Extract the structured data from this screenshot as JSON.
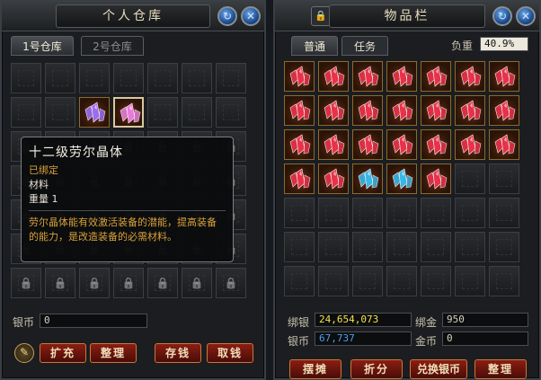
{
  "warehouse": {
    "title": "个人仓库",
    "tabs": [
      {
        "label": "1号仓库"
      },
      {
        "label": "2号仓库"
      }
    ],
    "silver_label": "银币",
    "silver_value": "0",
    "buttons": {
      "expand": "扩充",
      "sort": "整理",
      "deposit": "存钱",
      "withdraw": "取钱"
    }
  },
  "tooltip": {
    "name": "十二级劳尔晶体",
    "bound": "已绑定",
    "type": "材料",
    "weight": "重量 1",
    "description": "劳尔晶体能有效激活装备的潜能，提高装备的能力，是改造装备的必需材料。"
  },
  "inventory": {
    "title": "物品栏",
    "tabs": [
      {
        "label": "普通"
      },
      {
        "label": "任务"
      }
    ],
    "load_label": "负重",
    "load_value": "40.9%",
    "bound_silver_label": "绑银",
    "bound_silver_value": "24,654,073",
    "bound_gold_label": "绑金",
    "bound_gold_value": "950",
    "silver_label": "银币",
    "silver_value": "67,737",
    "gold_label": "金币",
    "gold_value": "0",
    "buttons": {
      "stall": "摆摊",
      "split": "折分",
      "exchange": "兑换银币",
      "sort": "整理"
    }
  },
  "colors": {
    "red_crystal": "#e8324a",
    "blue_crystal": "#39b6e6",
    "purple_crystal": "#9a6cf0",
    "pink_crystal": "#e87ad8",
    "bound_silver": "#f2e24a",
    "silver": "#4aa0f0"
  }
}
